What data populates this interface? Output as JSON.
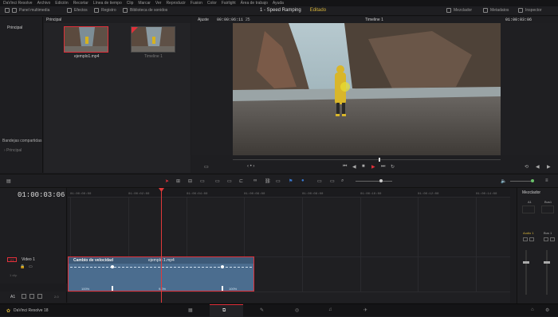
{
  "menu": [
    "DaVinci Resolve",
    "Archivo",
    "Edición",
    "Recortar",
    "Línea de tiempo",
    "Clip",
    "Marcar",
    "Ver",
    "Reproducir",
    "Fusion",
    "Color",
    "Fairlight",
    "Área de trabajo",
    "Ayuda"
  ],
  "toolbar": {
    "media_pool": "Panel multimedia",
    "effects": "Efectos",
    "index": "Registro",
    "sound_library": "Biblioteca de sonidos",
    "project_title": "1 - Speed Ramping",
    "edited": "Editado",
    "mixer": "Mezclador",
    "metadata": "Metadatos",
    "inspector": "Inspector"
  },
  "left": {
    "principal": "Principal",
    "shared_bins": "Bandejas compartidas",
    "shared_principal": "Principal"
  },
  "media": {
    "header": "Principal",
    "clip1": "ejemplo1.mp4",
    "clip2": "Timeline 1"
  },
  "viewer": {
    "zoom": "Ajuste",
    "source_tc": "00:00:06:11",
    "frames": "25",
    "timeline_name": "Timeline 1",
    "record_tc": "01:00:03:06"
  },
  "timeline": {
    "timecode": "01:00:03:06",
    "ruler": [
      "01:00:00:00",
      "01:00:02:00",
      "01:00:04:00",
      "01:00:06:00",
      "01:00:08:00",
      "01:00:10:00",
      "01:00:12:00",
      "01:00:14:00"
    ],
    "v1_badge": "V1",
    "v1_name": "Video 1",
    "v1_sub": "1 clip",
    "a1_name": "A1",
    "a1_val": "2.0"
  },
  "clip": {
    "speed_label": "Cambio de velocidad",
    "name": "ejemplo 1.mp4",
    "speed_left": "100%",
    "speed_mid": "9.0%",
    "speed_right": "100%"
  },
  "mixer": {
    "title": "Mezclador",
    "a1": "A1",
    "bus1": "Bus1",
    "audio1": "Audio 1",
    "bus1b": "Bus 1"
  },
  "footer": {
    "app": "DaVinci Resolve 18"
  },
  "colors": {
    "accent": "#e0303a",
    "clip": "#4b6d8f",
    "playhead": "#e03a3a",
    "edited": "#d6b33a"
  }
}
